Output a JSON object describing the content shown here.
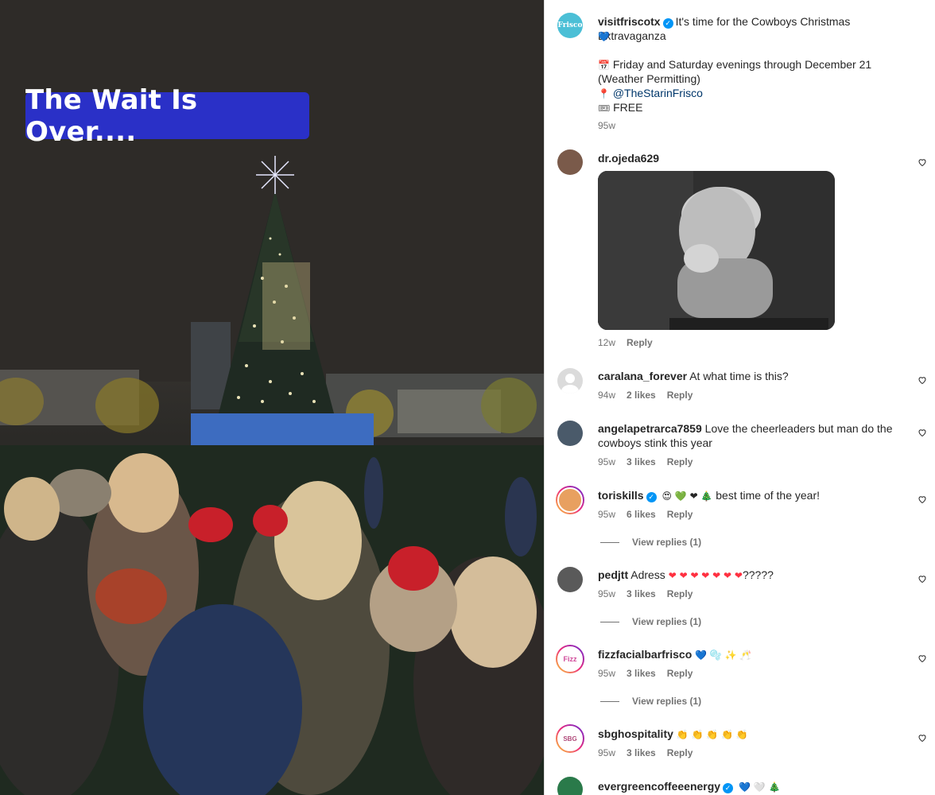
{
  "media": {
    "overlay_text": "The Wait Is Over...."
  },
  "post": {
    "username": "visitfriscotx",
    "avatar_text": "Frisco",
    "caption_line1": "It's time for the Cowboys Christmas Extravaganza",
    "emoji_heart": "💙",
    "line_calendar_icon": "📅",
    "line_schedule": "Friday and Saturday evenings through December 21",
    "line_weather": "(Weather Permitting)",
    "pin_icon": "📍",
    "mention": "@TheStarinFrisco",
    "ticket_icon": "🎟",
    "free": "FREE",
    "time": "95w"
  },
  "comments": [
    {
      "username": "dr.ojeda629",
      "text": "",
      "time": "12w",
      "likes": "",
      "reply": "Reply",
      "has_gif": true,
      "avatar_color": "#7a5a4a"
    },
    {
      "username": "caralana_forever",
      "text": "At what time is this?",
      "time": "94w",
      "likes": "2 likes",
      "reply": "Reply",
      "avatar_color": "#c7c7c7"
    },
    {
      "username": "angelapetrarca7859",
      "text": "Love the cheerleaders but man do the cowboys stink this year",
      "time": "95w",
      "likes": "3 likes",
      "reply": "Reply",
      "avatar_color": "#4a5a6a"
    },
    {
      "username": "toriskills",
      "verified": true,
      "text": "best time of the year!",
      "emojis": "😍 💚 ❤ 🎄",
      "time": "95w",
      "likes": "6 likes",
      "reply": "Reply",
      "view_replies": "View replies (1)",
      "avatar_color": "#e8a060"
    },
    {
      "username": "pedjtt",
      "text": "Adress",
      "emojis": "❤ ❤ ❤ ❤ ❤ ❤ ❤",
      "text_after": "?????",
      "time": "95w",
      "likes": "3 likes",
      "reply": "Reply",
      "view_replies": "View replies (1)",
      "avatar_color": "#5a5a5a"
    },
    {
      "username": "fizzfacialbarfrisco",
      "text": "",
      "emojis": "💙 🫧 ✨ 🥂",
      "time": "95w",
      "likes": "3 likes",
      "reply": "Reply",
      "view_replies": "View replies (1)",
      "avatar_text": "Fizz",
      "avatar_color": "#ffffff"
    },
    {
      "username": "sbghospitality",
      "text": "",
      "emojis": "👏 👏 👏 👏 👏",
      "time": "95w",
      "likes": "3 likes",
      "reply": "Reply",
      "avatar_text": "SBG",
      "avatar_color": "#ffffff"
    },
    {
      "username": "evergreencoffeeenergy",
      "verified": true,
      "text": "",
      "emojis": "💙 🤍 🎄",
      "avatar_color": "#2a7a4a"
    }
  ],
  "colors": {
    "banner_blue": "#2a30c7",
    "verified_blue": "#0095f6",
    "link_blue": "#00376b",
    "heart_red": "#ff3040"
  }
}
